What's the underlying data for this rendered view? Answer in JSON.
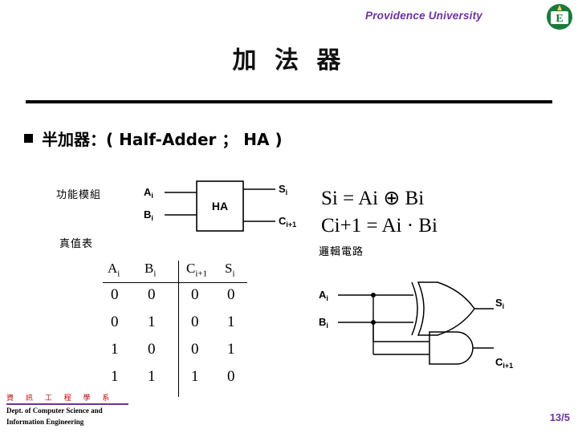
{
  "header": {
    "university": "Providence University",
    "logo_icon": "providence-university-crest-icon"
  },
  "title": "加 法 器",
  "bullet": {
    "marker_icon": "square-bullet-icon",
    "text": "半加器：( Half-Adder ； HA )"
  },
  "labels": {
    "function_block": "功能模組",
    "truth_table": "真值表",
    "logic_circuit": "邏輯電路"
  },
  "block_diagram": {
    "input_a": "Ai",
    "input_b": "Bi",
    "box_label": "HA",
    "output_s": "Si",
    "output_c": "Ci+1"
  },
  "equations": {
    "sum": "Si = Ai ⊕ Bi",
    "carry": "Ci+1 = Ai · Bi"
  },
  "truth_table": {
    "headers": [
      "Ai",
      "Bi",
      "Ci+1",
      "Si"
    ],
    "rows": [
      [
        "0",
        "0",
        "0",
        "0"
      ],
      [
        "0",
        "1",
        "0",
        "1"
      ],
      [
        "1",
        "0",
        "0",
        "1"
      ],
      [
        "1",
        "1",
        "1",
        "0"
      ]
    ]
  },
  "gate_circuit": {
    "input_a": "Ai",
    "input_b": "Bi",
    "output_s": "Si",
    "output_c": "Ci+1",
    "xor_gate_icon": "xor-gate-icon",
    "and_gate_icon": "and-gate-icon"
  },
  "footer": {
    "dept_cn": "資 訊 工 程 學 系",
    "dept_en_line1": "Dept. of Computer Science and",
    "dept_en_line2": "Information Engineering",
    "page_number": "13/5",
    "accent_color": "#7030A0"
  }
}
